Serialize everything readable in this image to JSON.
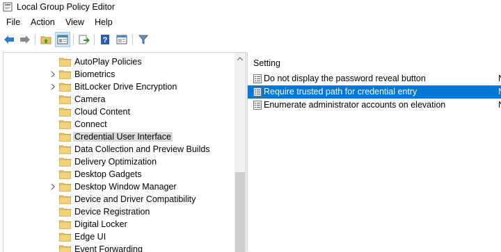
{
  "window": {
    "title": "Local Group Policy Editor"
  },
  "menu": [
    "File",
    "Action",
    "View",
    "Help"
  ],
  "toolbar": {
    "buttons": [
      "back-icon",
      "forward-icon",
      "up-folder-icon",
      "show-hide-tree-icon",
      "export-list-icon",
      "help-icon",
      "properties-icon",
      "filter-icon"
    ]
  },
  "tree": {
    "items": [
      {
        "label": "AutoPlay Policies",
        "expandable": false,
        "selected": false
      },
      {
        "label": "Biometrics",
        "expandable": true,
        "selected": false
      },
      {
        "label": "BitLocker Drive Encryption",
        "expandable": true,
        "selected": false
      },
      {
        "label": "Camera",
        "expandable": false,
        "selected": false
      },
      {
        "label": "Cloud Content",
        "expandable": false,
        "selected": false
      },
      {
        "label": "Connect",
        "expandable": false,
        "selected": false
      },
      {
        "label": "Credential User Interface",
        "expandable": false,
        "selected": true
      },
      {
        "label": "Data Collection and Preview Builds",
        "expandable": false,
        "selected": false
      },
      {
        "label": "Delivery Optimization",
        "expandable": false,
        "selected": false
      },
      {
        "label": "Desktop Gadgets",
        "expandable": false,
        "selected": false
      },
      {
        "label": "Desktop Window Manager",
        "expandable": true,
        "selected": false
      },
      {
        "label": "Device and Driver Compatibility",
        "expandable": false,
        "selected": false
      },
      {
        "label": "Device Registration",
        "expandable": false,
        "selected": false
      },
      {
        "label": "Digital Locker",
        "expandable": false,
        "selected": false
      },
      {
        "label": "Edge UI",
        "expandable": false,
        "selected": false
      },
      {
        "label": "Event Forwarding",
        "expandable": false,
        "selected": false
      }
    ]
  },
  "settings": {
    "column_header": "Setting",
    "rows": [
      {
        "label": "Do not display the password reveal button",
        "state": "N",
        "selected": false
      },
      {
        "label": "Require trusted path for credential entry",
        "state": "N",
        "selected": true
      },
      {
        "label": "Enumerate administrator accounts on elevation",
        "state": "N",
        "selected": false
      }
    ]
  },
  "colors": {
    "selection": "#0078d7",
    "tree_selection": "#d9d9d9",
    "folder": "#e8c262"
  }
}
